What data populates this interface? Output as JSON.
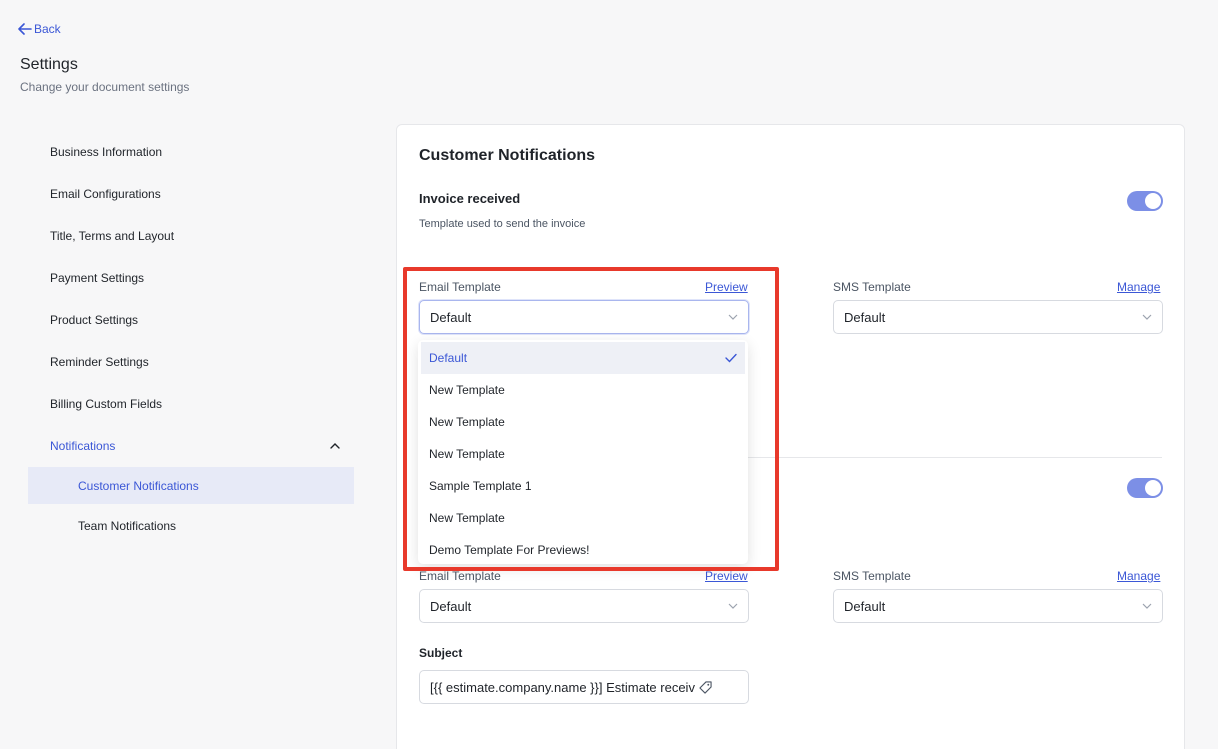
{
  "header": {
    "back_label": "Back",
    "title": "Settings",
    "subtitle": "Change your document settings"
  },
  "sidebar": {
    "items": [
      {
        "label": "Business Information"
      },
      {
        "label": "Email Configurations"
      },
      {
        "label": "Title, Terms and Layout"
      },
      {
        "label": "Payment Settings"
      },
      {
        "label": "Product Settings"
      },
      {
        "label": "Reminder Settings"
      },
      {
        "label": "Billing Custom Fields"
      },
      {
        "label": "Notifications",
        "expanded": true
      }
    ],
    "sub_items": [
      {
        "label": "Customer Notifications",
        "selected": true
      },
      {
        "label": "Team Notifications"
      }
    ]
  },
  "panel": {
    "title": "Customer Notifications",
    "section1": {
      "title": "Invoice received",
      "description": "Template used to send the invoice",
      "toggle_on": true,
      "email_label": "Email Template",
      "email_link": "Preview",
      "email_value": "Default",
      "sms_label": "SMS Template",
      "sms_link": "Manage",
      "sms_value": "Default"
    },
    "section2": {
      "toggle_on": true,
      "email_label": "Email Template",
      "email_link": "Preview",
      "email_value": "Default",
      "sms_label": "SMS Template",
      "sms_link": "Manage",
      "sms_value": "Default",
      "subject_label": "Subject",
      "subject_value": "[{{ estimate.company.name }}] Estimate receiv"
    }
  },
  "dropdown": {
    "options": [
      {
        "label": "Default",
        "selected": true
      },
      {
        "label": "New Template"
      },
      {
        "label": "New Template"
      },
      {
        "label": "New Template"
      },
      {
        "label": "Sample Template 1"
      },
      {
        "label": "New Template"
      },
      {
        "label": "Demo Template For Previews!"
      }
    ]
  },
  "colors": {
    "accent": "#3b57d6",
    "toggle": "#7c8fe6",
    "highlight": "#e8392b",
    "selected_bg": "#e7eaf7"
  },
  "icons": [
    "arrow-left-icon",
    "chevron-up-icon",
    "chevron-down-icon",
    "check-icon",
    "tag-icon"
  ]
}
